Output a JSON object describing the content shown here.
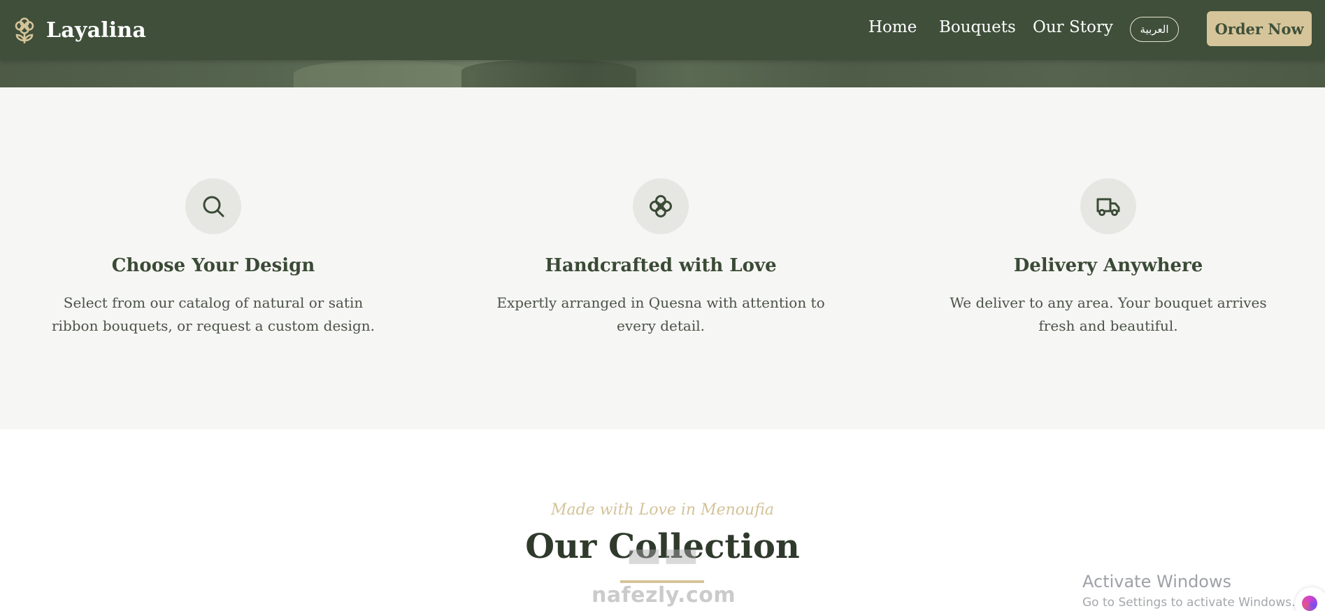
{
  "navbar": {
    "brand": "Layalina",
    "links": [
      "Home",
      "Bouquets",
      "Our Story"
    ],
    "language": "العربية",
    "cta": "Order Now"
  },
  "features": [
    {
      "icon": "search-icon",
      "title": "Choose Your Design",
      "description": "Select from our catalog of natural or satin ribbon bouquets, or request a custom design."
    },
    {
      "icon": "flower-icon",
      "title": "Handcrafted with Love",
      "description": "Expertly arranged in Quesna with attention to every detail."
    },
    {
      "icon": "truck-icon",
      "title": "Delivery Anywhere",
      "description": "We deliver to any area. Your bouquet arrives fresh and beautiful."
    }
  ],
  "collection": {
    "subtitle": "Made with Love in Menoufia",
    "title": "Our Collection"
  },
  "overlay": {
    "watermark": "nafezly.com",
    "activate_title": "Activate Windows",
    "activate_sub": "Go to Settings to activate Windows."
  },
  "colors": {
    "nav_bg": "#3f4f3a",
    "accent_gold": "#d6c59a",
    "section_bg": "#f6f6f4",
    "heading": "#3a4a36"
  }
}
